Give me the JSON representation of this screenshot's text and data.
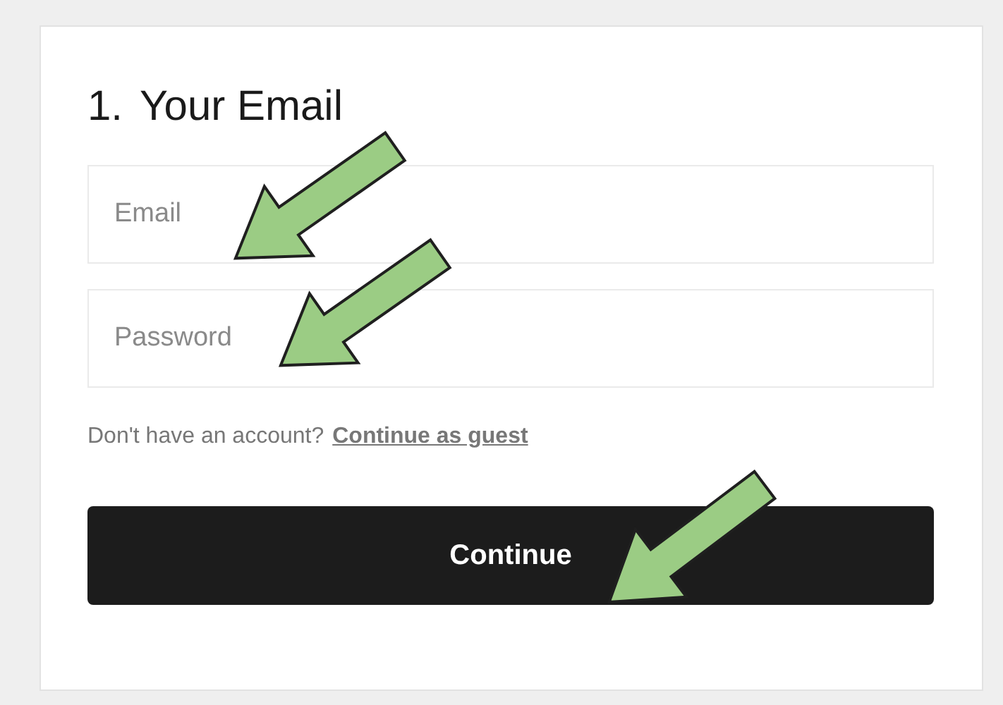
{
  "heading": {
    "number": "1.",
    "title": "Your Email"
  },
  "fields": [
    {
      "placeholder": "Email"
    },
    {
      "placeholder": "Password"
    }
  ],
  "account_prompt": {
    "text": "Don't have an account?",
    "link": "Continue as guest"
  },
  "button": "Continue"
}
